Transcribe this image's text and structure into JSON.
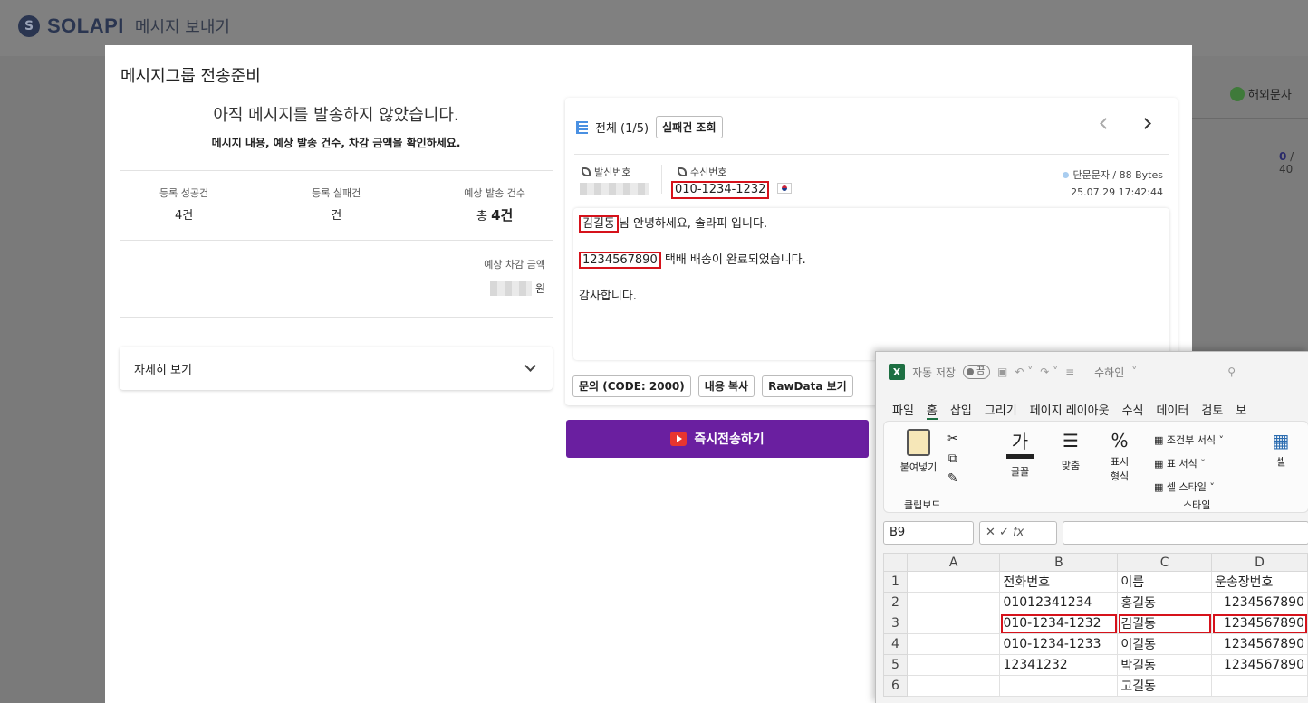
{
  "app": {
    "brand": "SOLAPI",
    "page_title": "메시지 보내기",
    "intl_label": "해외문자",
    "count_prefix": "0",
    "count_rest": " / 40"
  },
  "modal": {
    "title": "메시지그룹 전송준비",
    "status_title": "아직 메시지를 발송하지 않았습니다.",
    "status_sub": "메시지 내용, 예상 발송 건수, 차감 금액을 확인하세요.",
    "stats": [
      {
        "label": "등록 성공건",
        "value": "4건"
      },
      {
        "label": "등록 실패건",
        "value": "건"
      },
      {
        "label": "예상 발송 건수",
        "value_prefix": "총 ",
        "value_bold": "4건"
      }
    ],
    "cost_label": "예상 차감 금액",
    "cost_unit": "원",
    "detail_label": "자세히 보기",
    "send_button": "즉시전송하기"
  },
  "preview": {
    "header_label": "전체 (1/5)",
    "failed_chip": "실패건 조회",
    "sender_label": "발신번호",
    "receiver_label": "수신번호",
    "receiver_value": "010-1234-1232",
    "msg_type": "단문문자 / 88 Bytes",
    "timestamp": "25.07.29 17:42:44",
    "lines": [
      {
        "hl": "김길동",
        "rest": "님 안녕하세요, 솔라피 입니다."
      },
      {
        "hl": "1234567890",
        "rest": " 택배 배송이 완료되었습니다."
      },
      {
        "hl": "",
        "rest": "감사합니다."
      }
    ],
    "actions": [
      "문의 (CODE: 2000)",
      "내용 복사",
      "RawData 보기"
    ]
  },
  "excel": {
    "autosave_label": "자동 저장",
    "toggle_label": "끔",
    "doc_title": "수하인",
    "menu": [
      "파일",
      "홈",
      "삽입",
      "그리기",
      "페이지 레이아웃",
      "수식",
      "데이터",
      "검토",
      "보"
    ],
    "ribbon": {
      "paste": "붙여넣기",
      "clipboard": "클립보드",
      "font_glyph": "가",
      "font": "글꼴",
      "align": "맞춤",
      "number_glyph": "%",
      "number_l1": "표시",
      "number_l2": "형식",
      "cond_format": "조건부 서식",
      "table_format": "표 서식",
      "cell_style": "셀 스타일",
      "styles": "스타일",
      "cells": "셀"
    },
    "name_box": "B9",
    "fx": "fx",
    "columns": [
      "A",
      "B",
      "C",
      "D"
    ],
    "rows": [
      {
        "n": "1",
        "b": "전화번호",
        "c": "이름",
        "d": "운송장번호"
      },
      {
        "n": "2",
        "b": "01012341234",
        "c": "홍길동",
        "d": "1234567890"
      },
      {
        "n": "3",
        "b": "010-1234-1232",
        "c": "김길동",
        "d": "1234567890"
      },
      {
        "n": "4",
        "b": "010-1234-1233",
        "c": "이길동",
        "d": "1234567890"
      },
      {
        "n": "5",
        "b": "12341232",
        "c": "박길동",
        "d": "1234567890"
      },
      {
        "n": "6",
        "b": "",
        "c": "고길동",
        "d": ""
      }
    ]
  }
}
